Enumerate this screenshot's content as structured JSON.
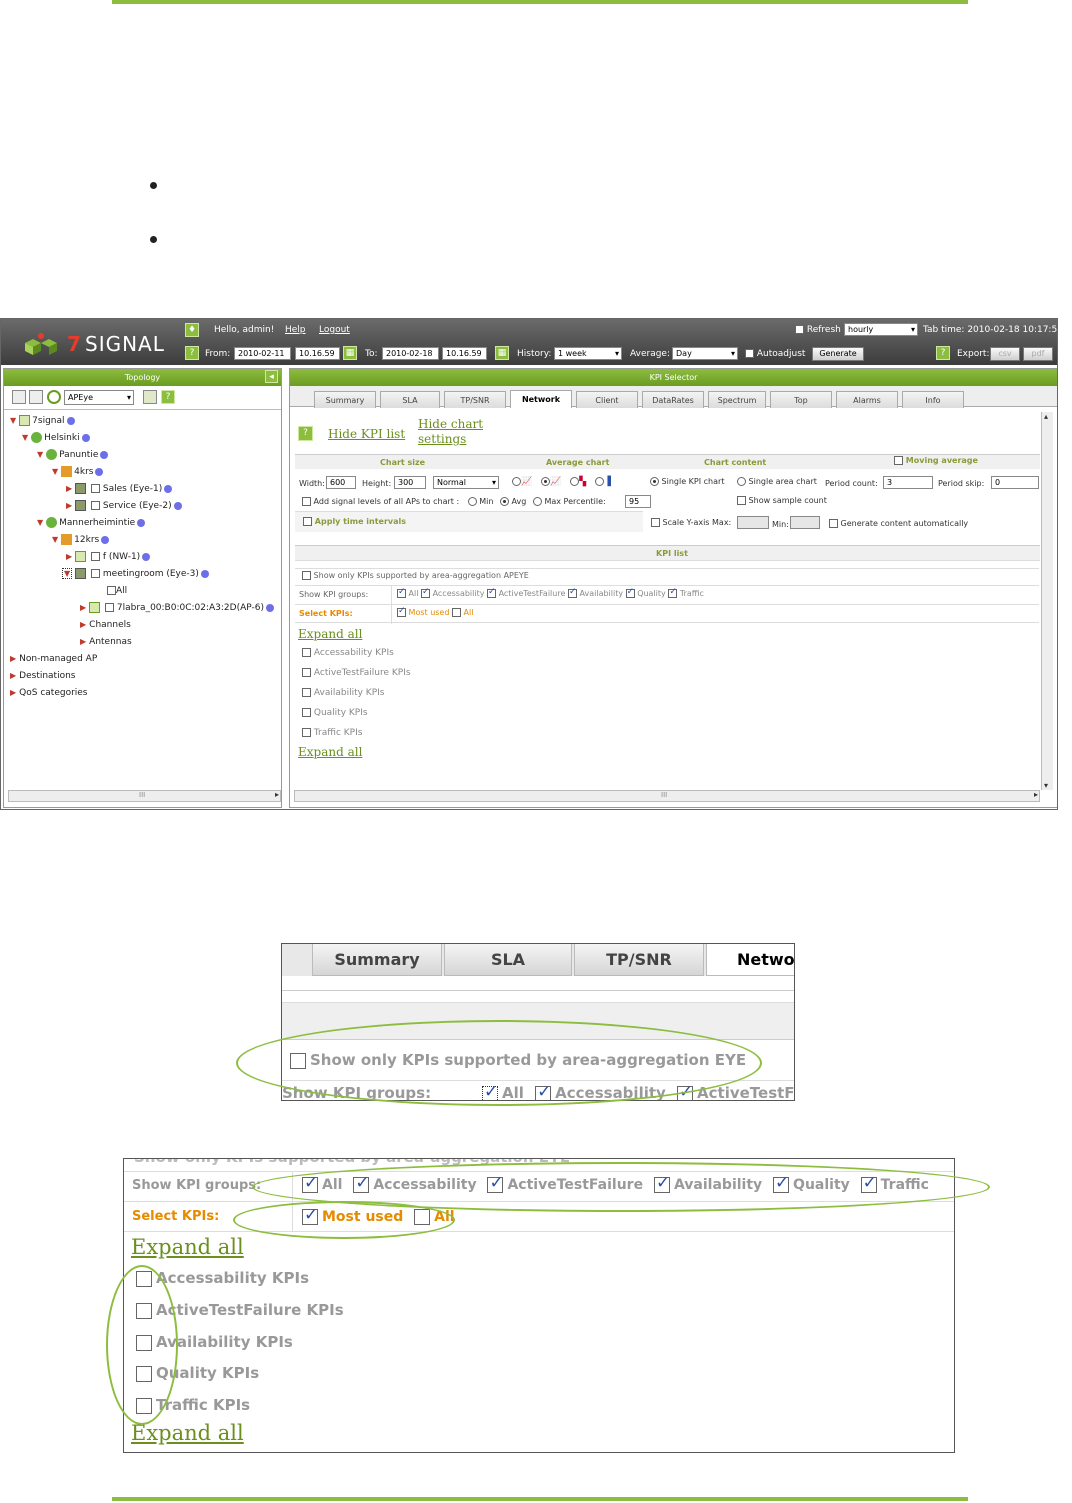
{
  "app": {
    "brand_seven": "7",
    "brand_name": "SIGNAL",
    "greeting": "Hello, admin!",
    "help": "Help",
    "logout": "Logout",
    "from_label": "From:",
    "from_date": "2010-02-11",
    "from_time": "10.16.59",
    "to_label": "To:",
    "to_date": "2010-02-18",
    "to_time": "10.16.59",
    "history_label": "History:",
    "history_value": "1 week",
    "average_label": "Average:",
    "average_value": "Day",
    "autoadjust_label": "Autoadjust",
    "generate": "Generate",
    "refresh_label": "Refresh",
    "refresh_value": "hourly",
    "tab_time": "Tab time: 2010-02-18 10:17:52",
    "export_label": "Export:",
    "csv": "csv",
    "pdf": "pdf"
  },
  "topology": {
    "title": "Topology",
    "selector": "APEye",
    "nodes": [
      {
        "label": "7signal"
      },
      {
        "label": "Helsinki"
      },
      {
        "label": "Panuntie"
      },
      {
        "label": "4krs"
      },
      {
        "label": "Sales (Eye-1)"
      },
      {
        "label": "Service (Eye-2)"
      },
      {
        "label": "Mannerheimintie"
      },
      {
        "label": "12krs"
      },
      {
        "label": "f (NW-1)"
      },
      {
        "label": "meetingroom (Eye-3)"
      },
      {
        "label": "All"
      },
      {
        "label": "7labra_00:B0:0C:02:A3:2D(AP-6)"
      },
      {
        "label": "Channels"
      },
      {
        "label": "Antennas"
      },
      {
        "label": "Non-managed AP"
      },
      {
        "label": "Destinations"
      },
      {
        "label": "QoS categories"
      }
    ],
    "scroll_mark": "III"
  },
  "kpi": {
    "title": "KPI Selector",
    "tabs": [
      "Summary",
      "SLA",
      "TP/SNR",
      "Network",
      "Client",
      "DataRates",
      "Spectrum",
      "Top",
      "Alarms",
      "Info"
    ],
    "hide_kpi_list": "Hide KPI list",
    "hide_chart_settings_1": "Hide chart",
    "hide_chart_settings_2": "settings",
    "chart_size": "Chart size",
    "average_chart": "Average chart",
    "chart_content": "Chart content",
    "moving_average": "Moving average",
    "width_label": "Width:",
    "width_value": "600",
    "height_label": "Height:",
    "height_value": "300",
    "size_mode": "Normal",
    "single_kpi_chart": "Single KPI chart",
    "single_area_chart": "Single area chart",
    "period_count_label": "Period count:",
    "period_count_value": "3",
    "period_skip_label": "Period skip:",
    "period_skip_value": "0",
    "add_signal_levels": "Add signal levels of all APs to chart :",
    "min": "Min",
    "avg": "Avg",
    "max": "Max",
    "percentile_label": "Percentile:",
    "percentile_value": "95",
    "show_sample_count": "Show sample count",
    "apply_time_intervals": "Apply time intervals",
    "scale_y_axis": "Scale Y-axis Max:",
    "min_label": "Min:",
    "generate_auto": "Generate content automatically",
    "kpi_list": "KPI list",
    "show_only_supported": "Show only KPIs supported by area-aggregation APEYE",
    "show_kpi_groups": "Show KPI groups:",
    "groups": [
      "All",
      "Accessability",
      "ActiveTestFailure",
      "Availability",
      "Quality",
      "Traffic"
    ],
    "select_kpis": "Select KPIs:",
    "most_used": "Most used",
    "all": "All",
    "expand_all": "Expand all",
    "kpi_items": [
      "Accessability KPIs",
      "ActiveTestFailure KPIs",
      "Availability KPIs",
      "Quality KPIs",
      "Traffic KPIs"
    ],
    "scroll_mark": "III"
  },
  "zoom1": {
    "tabs": [
      "Summary",
      "SLA",
      "TP/SNR",
      "Networ"
    ],
    "show_only_supported": "Show only KPIs supported by area-aggregation EYE",
    "show_kpi_groups": "Show KPI groups:",
    "groups_partial": [
      "All",
      "Accessability",
      "ActiveTestF"
    ]
  },
  "zoom2": {
    "cut_text": "Show only KPIs supported by area-aggregation EYE",
    "show_kpi_groups": "Show KPI groups:",
    "groups": [
      "All",
      "Accessability",
      "ActiveTestFailure",
      "Availability",
      "Quality",
      "Traffic"
    ],
    "select_kpis": "Select KPIs:",
    "most_used": "Most used",
    "all": "All",
    "expand_all": "Expand all",
    "kpi_items": [
      "Accessability KPIs",
      "ActiveTestFailure KPIs",
      "Availability KPIs",
      "Quality KPIs",
      "Traffic KPIs"
    ]
  },
  "colors": {
    "accent": "#8cbd3f",
    "link": "#6a8f1c",
    "orange": "#e68a00"
  }
}
